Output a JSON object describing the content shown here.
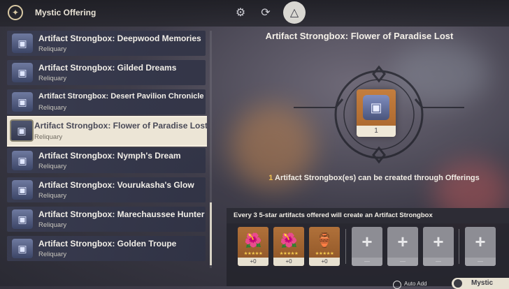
{
  "header": {
    "title": "Mystic Offering",
    "tabs": [
      {
        "icon": "gear-cycle-icon",
        "glyph": "⚙"
      },
      {
        "icon": "refresh-cycle-icon",
        "glyph": "⟳"
      },
      {
        "icon": "triangle-cycle-icon",
        "glyph": "△"
      }
    ]
  },
  "list": {
    "items": [
      {
        "name": "Artifact Strongbox: Deepwood Memories",
        "sub": "Reliquary"
      },
      {
        "name": "Artifact Strongbox: Gilded Dreams",
        "sub": "Reliquary"
      },
      {
        "name": "Artifact Strongbox: Desert Pavilion Chronicle",
        "sub": "Reliquary"
      },
      {
        "name": "Artifact Strongbox: Flower of Paradise Lost",
        "sub": "Reliquary"
      },
      {
        "name": "Artifact Strongbox: Nymph's Dream",
        "sub": "Reliquary"
      },
      {
        "name": "Artifact Strongbox: Vourukasha's Glow",
        "sub": "Reliquary"
      },
      {
        "name": "Artifact Strongbox: Marechaussee Hunter",
        "sub": "Reliquary"
      },
      {
        "name": "Artifact Strongbox: Golden Troupe",
        "sub": "Reliquary"
      }
    ],
    "selected_index": 3
  },
  "detail": {
    "title": "Artifact Strongbox: Flower of Paradise Lost",
    "count": "1",
    "info_number": "1",
    "info_text": " Artifact Strongbox(es) can be created through Offerings"
  },
  "offering": {
    "header": "Every 3 5-star artifacts offered will create an Artifact Strongbox",
    "filled_slots": [
      {
        "icon": "flower-artifact-icon",
        "stars": "★★★★★",
        "label": "+0"
      },
      {
        "icon": "flower-artifact-icon",
        "stars": "★★★★★",
        "label": "+0"
      },
      {
        "icon": "goblet-artifact-icon",
        "stars": "★★★★★",
        "label": "+0"
      }
    ],
    "empty_slots": [
      {
        "label": "—"
      },
      {
        "label": "—"
      },
      {
        "label": "—"
      },
      {
        "label": "—"
      }
    ]
  },
  "footer": {
    "auto_add_label": "Auto Add",
    "confirm_label": "Mystic"
  },
  "colors": {
    "accent_gold": "#f2c253",
    "selected_bg": "#ece5d6",
    "card_bronze": "#b1713a"
  }
}
